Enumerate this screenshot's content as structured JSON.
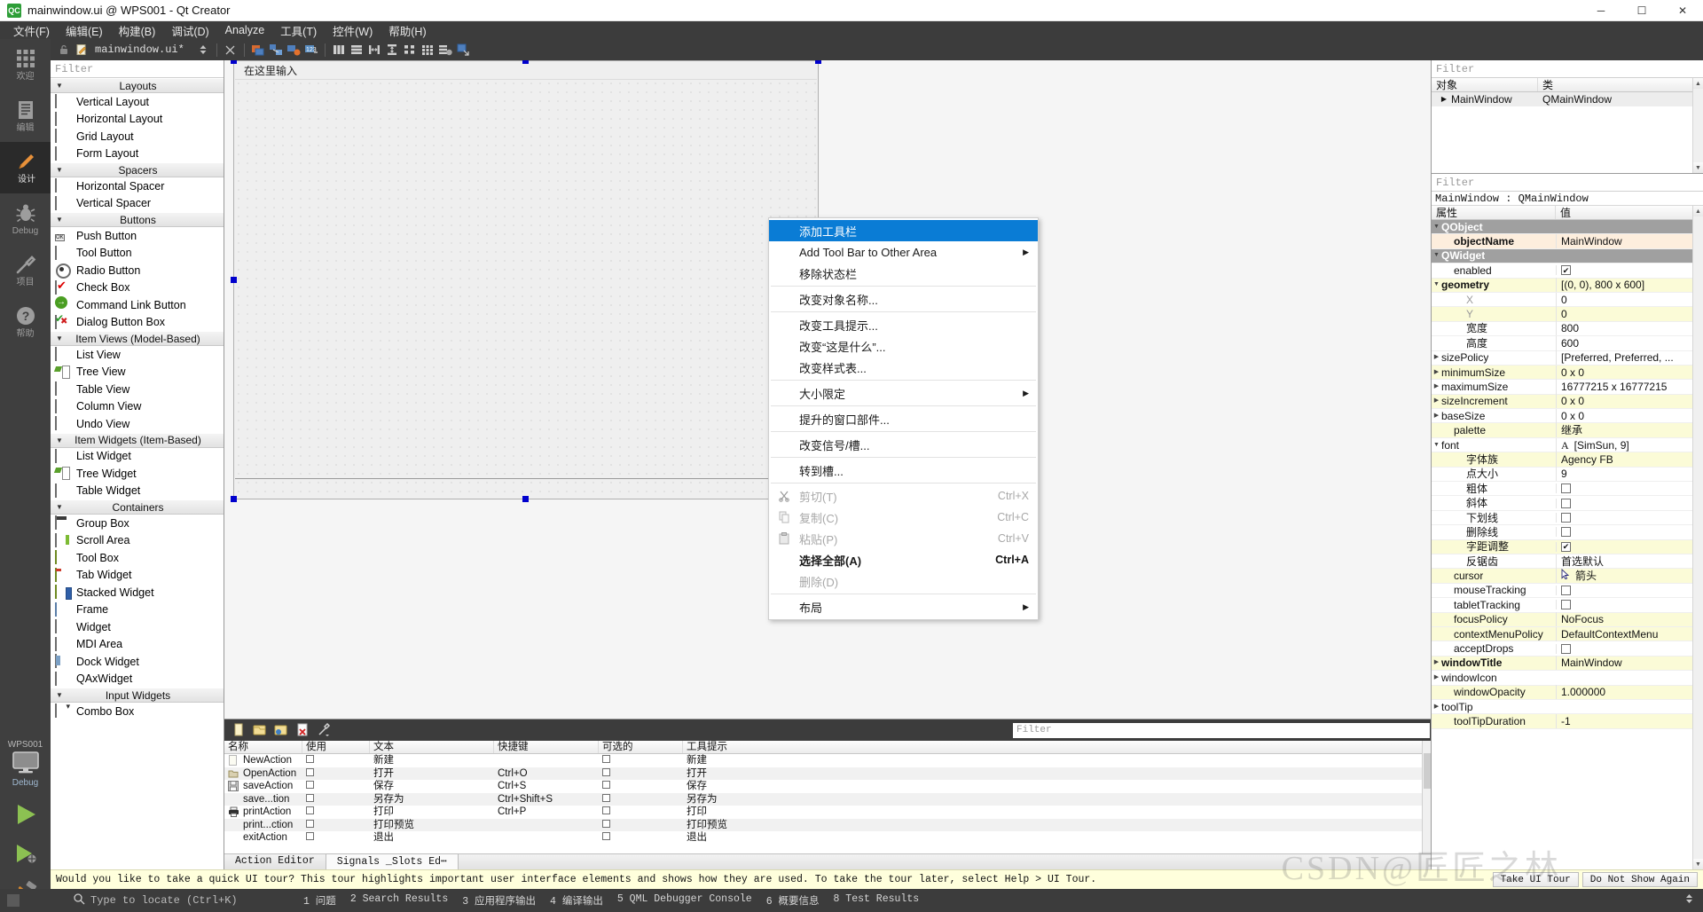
{
  "titlebar": {
    "icon": "qt-creator-icon",
    "title": "mainwindow.ui @ WPS001 - Qt Creator",
    "minimize": "─",
    "maximize": "☐",
    "close": "✕"
  },
  "menubar": {
    "items": [
      {
        "label": "文件(F)"
      },
      {
        "label": "编辑(E)"
      },
      {
        "label": "构建(B)"
      },
      {
        "label": "调试(D)"
      },
      {
        "label": "Analyze"
      },
      {
        "label": "工具(T)"
      },
      {
        "label": "控件(W)"
      },
      {
        "label": "帮助(H)"
      }
    ]
  },
  "modebar": {
    "modes": [
      {
        "label": "欢迎",
        "icon": "grid-icon"
      },
      {
        "label": "编辑",
        "icon": "document-icon"
      },
      {
        "label": "设计",
        "icon": "pencil-icon",
        "active": true
      },
      {
        "label": "Debug",
        "icon": "bug-icon"
      },
      {
        "label": "项目",
        "icon": "wrench-icon"
      },
      {
        "label": "帮助",
        "icon": "question-icon"
      }
    ],
    "kit": {
      "name": "WPS001",
      "config": "Debug",
      "icon": "monitor-icon"
    },
    "run_buttons": [
      {
        "icon": "run-icon",
        "name": "run"
      },
      {
        "icon": "debug-run-icon",
        "name": "start-debugging"
      },
      {
        "icon": "build-hammer-icon",
        "name": "build"
      }
    ]
  },
  "editor_toolbar": {
    "filename": "mainwindow.ui*",
    "lock_icon": "lock-icon",
    "file_icon": "ui-file-icon",
    "split_icon": "updown-arrows-icon",
    "close_icon": "close-x-icon",
    "tools": [
      "edit-widgets-icon",
      "edit-signals-slots-icon",
      "edit-buddies-icon",
      "edit-tab-order-icon",
      "layout-horizontally-icon",
      "layout-vertically-icon",
      "layout-splitter-h-icon",
      "layout-splitter-v-icon",
      "layout-form-icon",
      "layout-grid-icon",
      "break-layout-icon",
      "adjust-size-icon"
    ]
  },
  "widgetbox": {
    "filter_placeholder": "Filter",
    "groups": [
      {
        "title": "Layouts",
        "items": [
          {
            "label": "Vertical Layout",
            "icon": "vertical-layout-icon",
            "cls": "vlay"
          },
          {
            "label": "Horizontal Layout",
            "icon": "horizontal-layout-icon",
            "cls": "hlay"
          },
          {
            "label": "Grid Layout",
            "icon": "grid-layout-icon",
            "cls": "grid"
          },
          {
            "label": "Form Layout",
            "icon": "form-layout-icon",
            "cls": "form"
          }
        ]
      },
      {
        "title": "Spacers",
        "items": [
          {
            "label": "Horizontal Spacer",
            "icon": "horizontal-spacer-icon",
            "cls": "hsp"
          },
          {
            "label": "Vertical Spacer",
            "icon": "vertical-spacer-icon",
            "cls": "vsp"
          }
        ]
      },
      {
        "title": "Buttons",
        "items": [
          {
            "label": "Push Button",
            "icon": "push-button-icon",
            "cls": "push"
          },
          {
            "label": "Tool Button",
            "icon": "tool-button-icon",
            "cls": "tool"
          },
          {
            "label": "Radio Button",
            "icon": "radio-button-icon",
            "cls": "radio"
          },
          {
            "label": "Check Box",
            "icon": "check-box-icon",
            "cls": "check"
          },
          {
            "label": "Command Link Button",
            "icon": "command-link-button-icon",
            "cls": "cmd"
          },
          {
            "label": "Dialog Button Box",
            "icon": "dialog-button-box-icon",
            "cls": "dlg"
          }
        ]
      },
      {
        "title": "Item Views (Model-Based)",
        "items": [
          {
            "label": "List View",
            "icon": "list-view-icon",
            "cls": "listv"
          },
          {
            "label": "Tree View",
            "icon": "tree-view-icon",
            "cls": "treev"
          },
          {
            "label": "Table View",
            "icon": "table-view-icon",
            "cls": "tablev"
          },
          {
            "label": "Column View",
            "icon": "column-view-icon",
            "cls": "colv"
          },
          {
            "label": "Undo View",
            "icon": "undo-view-icon",
            "cls": "listv"
          }
        ]
      },
      {
        "title": "Item Widgets (Item-Based)",
        "items": [
          {
            "label": "List Widget",
            "icon": "list-widget-icon",
            "cls": "listv"
          },
          {
            "label": "Tree Widget",
            "icon": "tree-widget-icon",
            "cls": "treev"
          },
          {
            "label": "Table Widget",
            "icon": "table-widget-icon",
            "cls": "tablev"
          }
        ]
      },
      {
        "title": "Containers",
        "items": [
          {
            "label": "Group Box",
            "icon": "group-box-icon",
            "cls": "group"
          },
          {
            "label": "Scroll Area",
            "icon": "scroll-area-icon",
            "cls": "scroll"
          },
          {
            "label": "Tool Box",
            "icon": "tool-box-icon",
            "cls": "toolbox"
          },
          {
            "label": "Tab Widget",
            "icon": "tab-widget-icon",
            "cls": "tabw"
          },
          {
            "label": "Stacked Widget",
            "icon": "stacked-widget-icon",
            "cls": "stackw"
          },
          {
            "label": "Frame",
            "icon": "frame-icon",
            "cls": "frame"
          },
          {
            "label": "Widget",
            "icon": "widget-icon",
            "cls": "widget"
          },
          {
            "label": "MDI Area",
            "icon": "mdi-area-icon",
            "cls": "mdi"
          },
          {
            "label": "Dock Widget",
            "icon": "dock-widget-icon",
            "cls": "dock"
          },
          {
            "label": "QAxWidget",
            "icon": "qax-widget-icon",
            "cls": "qax"
          }
        ]
      },
      {
        "title": "Input Widgets",
        "items": [
          {
            "label": "Combo Box",
            "icon": "combo-box-icon",
            "cls": "combo"
          }
        ]
      }
    ]
  },
  "form": {
    "menubar_hint": "在这里输入"
  },
  "context_menu": {
    "items": [
      {
        "label": "添加工具栏",
        "selected": true
      },
      {
        "label": "Add Tool Bar to Other Area",
        "submenu": true
      },
      {
        "label": "移除状态栏"
      },
      {
        "sep": true
      },
      {
        "label": "改变对象名称..."
      },
      {
        "sep": true
      },
      {
        "label": "改变工具提示..."
      },
      {
        "label": "改变“这是什么”..."
      },
      {
        "label": "改变样式表..."
      },
      {
        "sep": true
      },
      {
        "label": "大小限定",
        "submenu": true
      },
      {
        "sep": true
      },
      {
        "label": "提升的窗口部件..."
      },
      {
        "sep": true
      },
      {
        "label": "改变信号/槽..."
      },
      {
        "sep": true
      },
      {
        "label": "转到槽..."
      },
      {
        "sep": true
      },
      {
        "label": "剪切(T)",
        "shortcut": "Ctrl+X",
        "disabled": true,
        "icon": "cut-icon"
      },
      {
        "label": "复制(C)",
        "shortcut": "Ctrl+C",
        "disabled": true,
        "icon": "copy-icon"
      },
      {
        "label": "粘贴(P)",
        "shortcut": "Ctrl+V",
        "disabled": true,
        "icon": "paste-icon"
      },
      {
        "label": "选择全部(A)",
        "shortcut": "Ctrl+A",
        "bold_shortcut": true
      },
      {
        "label": "删除(D)",
        "disabled": true
      },
      {
        "sep": true
      },
      {
        "label": "布局",
        "submenu": true
      }
    ]
  },
  "action_editor": {
    "filter_placeholder": "Filter",
    "toolbar_icons": [
      "new-action-icon",
      "open-icon",
      "edit-action-icon",
      "delete-action-icon",
      "settings-icon"
    ],
    "columns": [
      "名称",
      "使用",
      "文本",
      "快捷键",
      "可选的",
      "工具提示"
    ],
    "rows": [
      {
        "name": "NewAction",
        "used": false,
        "text": "新建",
        "shortcut": "",
        "checkable": false,
        "tooltip": "新建",
        "icon": "new-file-icon"
      },
      {
        "name": "OpenAction",
        "used": false,
        "text": "打开",
        "shortcut": "Ctrl+O",
        "checkable": false,
        "tooltip": "打开",
        "icon": "open-folder-icon"
      },
      {
        "name": "saveAction",
        "used": false,
        "text": "保存",
        "shortcut": "Ctrl+S",
        "checkable": false,
        "tooltip": "保存",
        "icon": "save-icon"
      },
      {
        "name": "save...tion",
        "used": false,
        "text": "另存为",
        "shortcut": "Ctrl+Shift+S",
        "checkable": false,
        "tooltip": "另存为",
        "icon": ""
      },
      {
        "name": "printAction",
        "used": false,
        "text": "打印",
        "shortcut": "Ctrl+P",
        "checkable": false,
        "tooltip": "打印",
        "icon": "print-icon"
      },
      {
        "name": "print...ction",
        "used": false,
        "text": "打印预览",
        "shortcut": "",
        "checkable": false,
        "tooltip": "打印预览",
        "icon": ""
      },
      {
        "name": "exitAction",
        "used": false,
        "text": "退出",
        "shortcut": "",
        "checkable": false,
        "tooltip": "退出",
        "icon": ""
      }
    ],
    "tabs": [
      {
        "label": "Action Editor",
        "active": false
      },
      {
        "label": "Signals _Slots Ed⋯",
        "active": true
      }
    ]
  },
  "object_inspector": {
    "filter_placeholder": "Filter",
    "columns": [
      "对象",
      "类"
    ],
    "rows": [
      {
        "object": "MainWindow",
        "class": "QMainWindow",
        "expandable": true
      }
    ]
  },
  "property_editor": {
    "filter_placeholder": "Filter",
    "add_icon": "plus-icon",
    "remove_icon": "minus-icon",
    "config_icon": "wrench-icon",
    "selected_label": "MainWindow : QMainWindow",
    "columns": [
      "属性",
      "值"
    ],
    "rows": [
      {
        "key": "QObject",
        "value": "",
        "type": "group",
        "expander": "▼",
        "indent": 0
      },
      {
        "key": "objectName",
        "value": "MainWindow",
        "type": "peach",
        "indent": 1,
        "bold": true
      },
      {
        "key": "QWidget",
        "value": "",
        "type": "group",
        "expander": "▼",
        "indent": 0
      },
      {
        "key": "enabled",
        "value": "",
        "type": "white",
        "indent": 1,
        "checkbox": true,
        "checked": true
      },
      {
        "key": "geometry",
        "value": "[(0, 0), 800 x 600]",
        "type": "yellow",
        "indent": 0,
        "expander": "▼",
        "bold": true
      },
      {
        "key": "X",
        "value": "0",
        "type": "white",
        "indent": 2,
        "gray": true
      },
      {
        "key": "Y",
        "value": "0",
        "type": "yellow",
        "indent": 2,
        "gray": true
      },
      {
        "key": "宽度",
        "value": "800",
        "type": "white",
        "indent": 2
      },
      {
        "key": "高度",
        "value": "600",
        "type": "white",
        "indent": 2
      },
      {
        "key": "sizePolicy",
        "value": "[Preferred, Preferred, ...",
        "type": "white",
        "indent": 0,
        "expander": "▶"
      },
      {
        "key": "minimumSize",
        "value": "0 x 0",
        "type": "yellow",
        "indent": 0,
        "expander": "▶"
      },
      {
        "key": "maximumSize",
        "value": "16777215 x 16777215",
        "type": "white",
        "indent": 0,
        "expander": "▶"
      },
      {
        "key": "sizeIncrement",
        "value": "0 x 0",
        "type": "yellow",
        "indent": 0,
        "expander": "▶"
      },
      {
        "key": "baseSize",
        "value": "0 x 0",
        "type": "white",
        "indent": 0,
        "expander": "▶"
      },
      {
        "key": "palette",
        "value": "继承",
        "type": "yellow",
        "indent": 1
      },
      {
        "key": "font",
        "value": "[SimSun, 9]",
        "type": "white",
        "indent": 0,
        "expander": "▼",
        "font_glyph": "A"
      },
      {
        "key": "字体族",
        "value": "Agency FB",
        "type": "yellow",
        "indent": 2
      },
      {
        "key": "点大小",
        "value": "9",
        "type": "white",
        "indent": 2
      },
      {
        "key": "粗体",
        "value": "",
        "type": "white",
        "indent": 2,
        "checkbox": true,
        "checked": false
      },
      {
        "key": "斜体",
        "value": "",
        "type": "white",
        "indent": 2,
        "checkbox": true,
        "checked": false
      },
      {
        "key": "下划线",
        "value": "",
        "type": "white",
        "indent": 2,
        "checkbox": true,
        "checked": false
      },
      {
        "key": "删除线",
        "value": "",
        "type": "white",
        "indent": 2,
        "checkbox": true,
        "checked": false
      },
      {
        "key": "字距调整",
        "value": "",
        "type": "yellow",
        "indent": 2,
        "checkbox": true,
        "checked": true
      },
      {
        "key": "反锯齿",
        "value": "首选默认",
        "type": "white",
        "indent": 2
      },
      {
        "key": "cursor",
        "value": "箭头",
        "type": "yellow",
        "indent": 1,
        "cursor_glyph": true
      },
      {
        "key": "mouseTracking",
        "value": "",
        "type": "white",
        "indent": 1,
        "checkbox": true,
        "checked": false
      },
      {
        "key": "tabletTracking",
        "value": "",
        "type": "white",
        "indent": 1,
        "checkbox": true,
        "checked": false
      },
      {
        "key": "focusPolicy",
        "value": "NoFocus",
        "type": "yellow",
        "indent": 1
      },
      {
        "key": "contextMenuPolicy",
        "value": "DefaultContextMenu",
        "type": "yellow",
        "indent": 1
      },
      {
        "key": "acceptDrops",
        "value": "",
        "type": "white",
        "indent": 1,
        "checkbox": true,
        "checked": false
      },
      {
        "key": "windowTitle",
        "value": "MainWindow",
        "type": "yellow",
        "indent": 0,
        "expander": "▶",
        "bold": true
      },
      {
        "key": "windowIcon",
        "value": "",
        "type": "white",
        "indent": 0,
        "expander": "▶"
      },
      {
        "key": "windowOpacity",
        "value": "1.000000",
        "type": "yellow",
        "indent": 1
      },
      {
        "key": "toolTip",
        "value": "",
        "type": "white",
        "indent": 0,
        "expander": "▶"
      },
      {
        "key": "toolTipDuration",
        "value": "-1",
        "type": "yellow",
        "indent": 1
      }
    ]
  },
  "tour_banner": {
    "message": "Would you like to take a quick UI tour? This tour highlights important user interface elements and shows how they are used. To take the tour later, select Help > UI Tour.",
    "take_tour": "Take UI Tour",
    "dismiss": "Do Not Show Again"
  },
  "statusbar": {
    "locate_placeholder": "Type to locate (Ctrl+K)",
    "search_icon": "search-icon",
    "items": [
      {
        "num": "1",
        "label": "问题"
      },
      {
        "num": "2",
        "label": "Search Results"
      },
      {
        "num": "3",
        "label": "应用程序输出"
      },
      {
        "num": "4",
        "label": "编译输出"
      },
      {
        "num": "5",
        "label": "QML Debugger Console"
      },
      {
        "num": "6",
        "label": "概要信息"
      },
      {
        "num": "8",
        "label": "Test Results"
      }
    ]
  },
  "watermark": "CSDN@匠匠之林"
}
